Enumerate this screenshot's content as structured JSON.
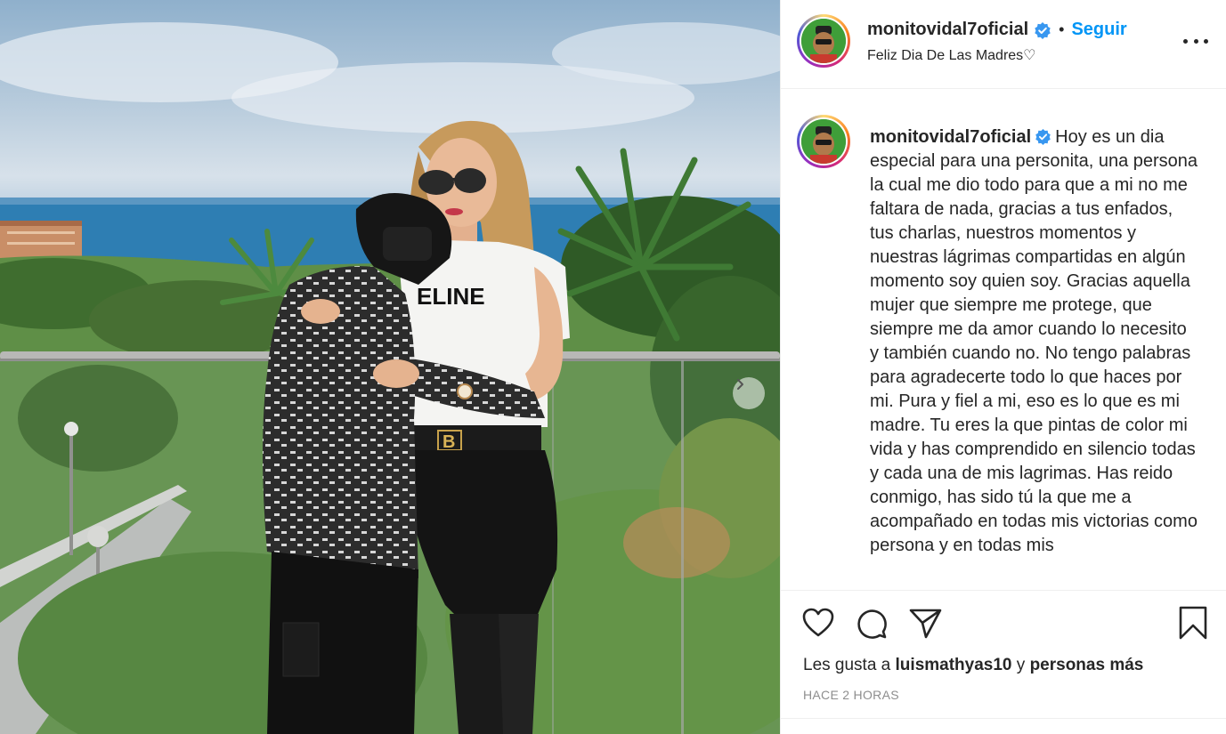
{
  "post": {
    "username": "monitovidal7oficial",
    "follow_label": "Seguir",
    "separator": "•",
    "location": "Feliz Dia De Las Madres♡",
    "caption": "Hoy es un dia especial para una personita, una persona la cual me dio todo para que a mi no me faltara de nada, gracias a tus enfados, tus charlas, nuestros momentos y nuestras lágrimas compartidas en algún momento soy quien soy. Gracias aquella mujer que siempre me protege, que siempre me da amor cuando lo necesito y también cuando no. No tengo palabras para agradecerte todo lo que haces por mi. Pura y fiel a mi, eso es lo que es mi madre. Tu eres la que pintas de color mi vida y has comprendido en silencio todas y cada una de mis lagrimas. Has reido conmigo, has sido tú la que me a acompañado en todas mis victorias como persona y en todas mis",
    "likes_prefix": "Les gusta a",
    "likes_user": "luismathyas10",
    "likes_and": "y",
    "likes_rest": "personas más",
    "timestamp": "HACE 2 HORAS",
    "shirt_text": "ELINE",
    "belt_text": "B"
  },
  "colors": {
    "accent": "#0095f6",
    "verified": "#3897f0",
    "text": "#262626",
    "muted": "#8e8e8e"
  },
  "icons": [
    "verified-badge-icon",
    "more-options-icon",
    "heart-icon",
    "comment-icon",
    "share-icon",
    "bookmark-icon",
    "chevron-right-icon"
  ]
}
